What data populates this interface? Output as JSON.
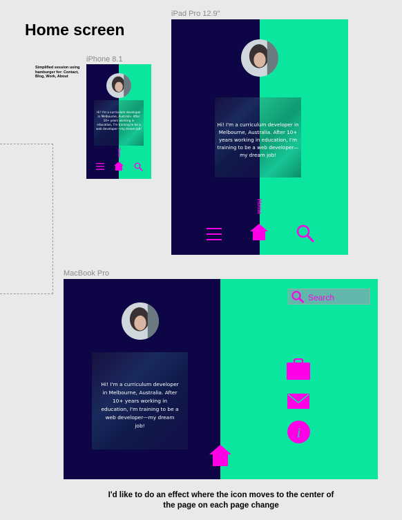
{
  "page": {
    "title": "Home screen",
    "note": "Simplified session using hamburger for: Contact, Blog, Work, About",
    "caption": "I'd like to do an effect where the icon moves to the center of the page on each page change"
  },
  "frames": {
    "iphone": {
      "label": "iPhone 8.1",
      "bio": "Hi! I'm a curriculum developer in Melbourne, Australia. After 10+ years working in education, I'm training to be a web developer—my dream job!",
      "home_label": "Home"
    },
    "ipad": {
      "label": "iPad Pro 12.9\"",
      "bio": "Hi! I'm a curriculum developer in Melbourne, Australia. After 10+ years working in education, I'm training to be a web developer—my dream job!",
      "home_label": "Home"
    },
    "macbook": {
      "label": "MacBook Pro",
      "bio": "Hi! I'm a curriculum developer in Melbourne, Australia. After 10+ years working in education, I'm training to be a web developer—my dream job!",
      "search_placeholder": "Search"
    }
  },
  "colors": {
    "navy": "#0e0547",
    "green": "#0be69f",
    "magenta": "#ff00e6"
  },
  "icons": [
    "hamburger-icon",
    "home-icon",
    "search-icon",
    "briefcase-icon",
    "mail-icon",
    "info-icon"
  ]
}
